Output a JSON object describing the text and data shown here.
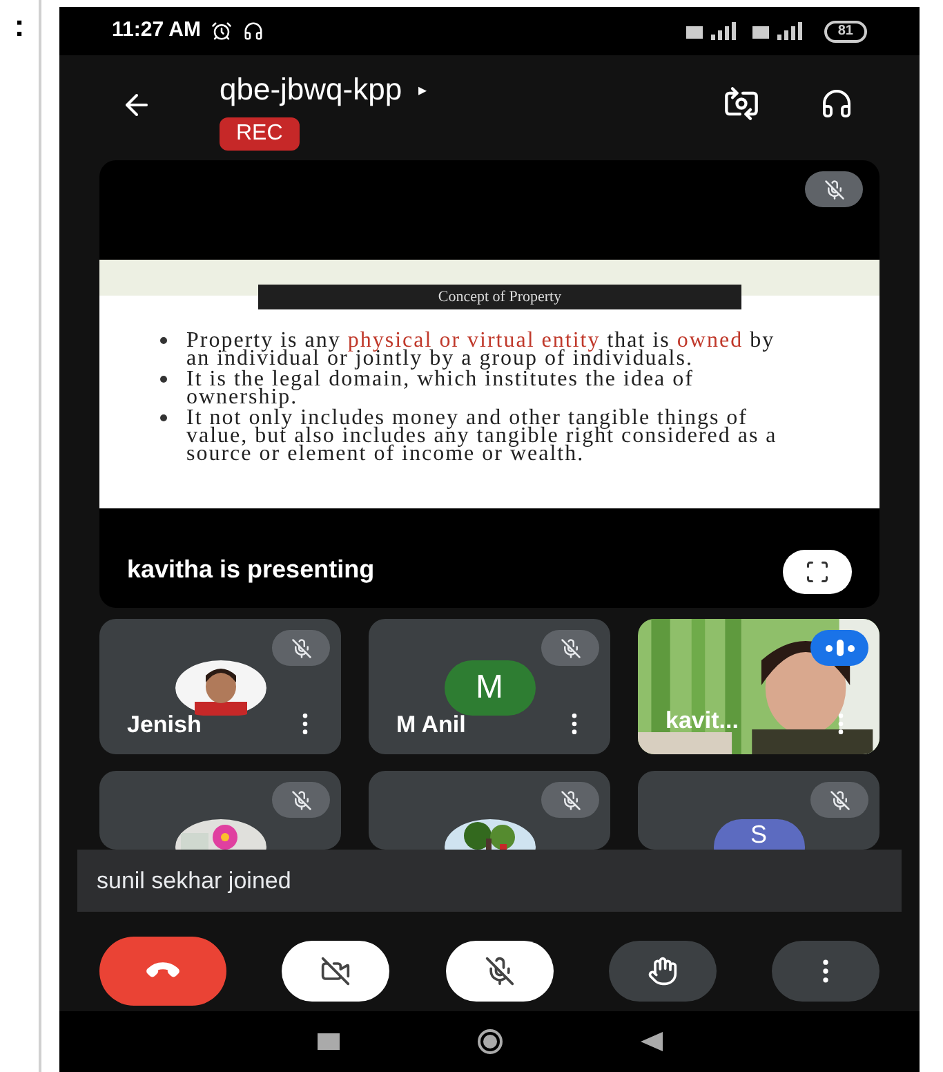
{
  "side_mark": ":",
  "status_bar": {
    "time": "11:27 AM",
    "battery": "81"
  },
  "header": {
    "title": "qbe-jbwq-kpp",
    "title_caret": "▸",
    "rec_badge": "REC"
  },
  "presentation": {
    "muted": true,
    "slide": {
      "title": "Concept of Property",
      "bullets": [
        [
          {
            "text": "Property is any ",
            "highlight": false
          },
          {
            "text": "physical or virtual entity",
            "highlight": true
          },
          {
            "text": " that is ",
            "highlight": false
          },
          {
            "text": "owned",
            "highlight": true
          },
          {
            "text": " by an individual or jointly by a group of individuals.",
            "highlight": false
          }
        ],
        [
          {
            "text": "It is the legal domain, which institutes the idea of ownership.",
            "highlight": false
          }
        ],
        [
          {
            "text": " It not only includes money and other tangible things of value, but also includes any tangible right considered as a source or element of income or wealth.",
            "highlight": false
          }
        ]
      ]
    },
    "caption": "kavitha is presenting"
  },
  "participants": [
    {
      "name": "Jenish",
      "muted": true,
      "speaking": false
    },
    {
      "name": "M Anil",
      "kind": "letter",
      "letter": "M",
      "color": "#2e7d32",
      "muted": true,
      "speaking": false
    },
    {
      "name": "kavit...",
      "kind": "video",
      "muted": false,
      "speaking": true
    },
    {
      "kind": "flower",
      "muted": true,
      "speaking": false
    },
    {
      "kind": "tree",
      "muted": true,
      "speaking": false
    },
    {
      "kind": "letter",
      "letter": "S",
      "color": "#5c6bc0",
      "muted": true,
      "speaking": false
    }
  ],
  "toast": "sunil sekhar joined",
  "controls": {
    "camera_on": false,
    "mic_on": false
  }
}
